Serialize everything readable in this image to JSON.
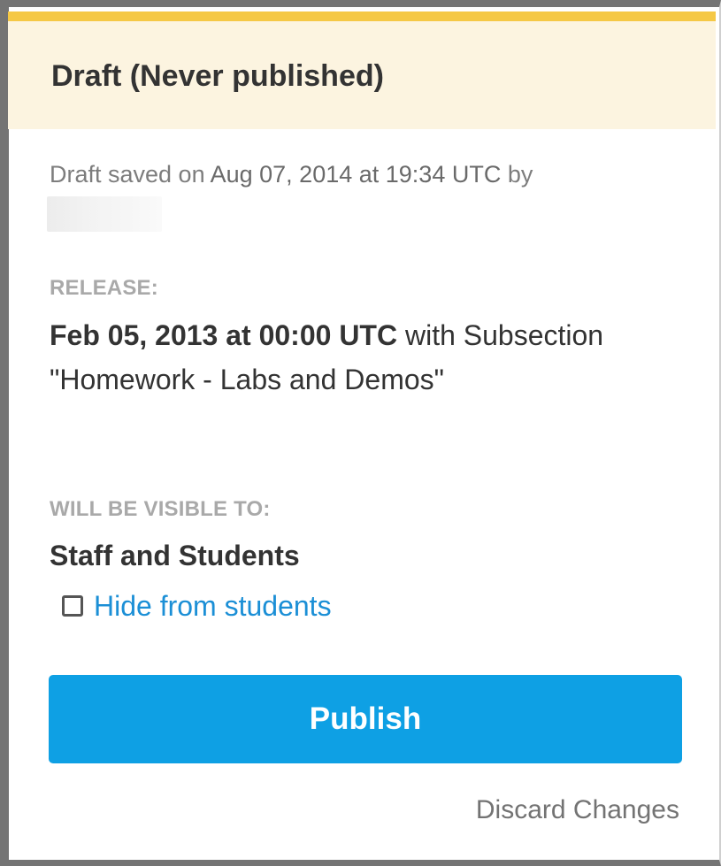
{
  "header": {
    "title": "Draft (Never published)"
  },
  "draft": {
    "prefix": "Draft saved on ",
    "date": "Aug 07, 2014 at 19:34 UTC",
    "suffix": " by"
  },
  "release": {
    "label": "RELEASE:",
    "date": "Feb 05, 2013 at 00:00 UTC",
    "with_text": " with Subsection \"Homework - Labs and Demos\""
  },
  "visibility": {
    "label": "WILL BE VISIBLE TO:",
    "value": "Staff and Students",
    "hide_label": "Hide from students",
    "hide_checked": false
  },
  "actions": {
    "publish_label": "Publish",
    "discard_label": "Discard Changes"
  },
  "colors": {
    "accent": "#f5c845",
    "header_bg": "#fcf4e0",
    "primary_button": "#0ea0e4",
    "link": "#1b8fd6"
  }
}
